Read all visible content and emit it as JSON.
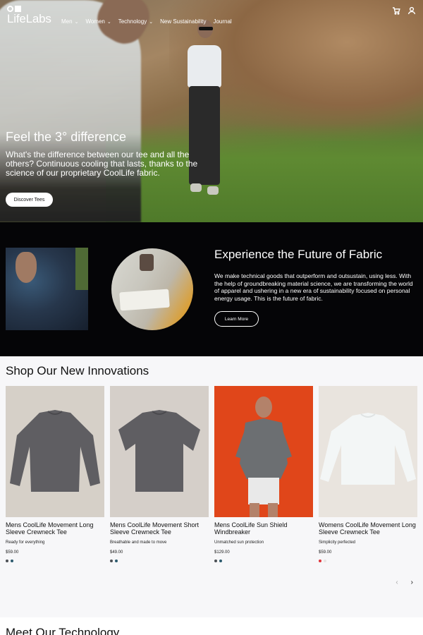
{
  "brand": {
    "name": "LifeLabs"
  },
  "nav": {
    "items": [
      {
        "label": "Men",
        "chevron": true
      },
      {
        "label": "Women",
        "chevron": true
      },
      {
        "label": "Technology",
        "chevron": true
      },
      {
        "label": "New Sustainability",
        "chevron": false
      },
      {
        "label": "Journal",
        "chevron": false
      }
    ],
    "icons": [
      "cart-icon",
      "account-icon"
    ]
  },
  "hero": {
    "title": "Feel the 3° difference",
    "body": "What's the difference between our tee and all the others? Continuous cooling that lasts, thanks to the science of our proprietary CoolLife fabric.",
    "cta": "Discover Tees"
  },
  "fabric": {
    "title": "Experience the Future of Fabric",
    "body": "We make technical goods that outperform and outsustain, using less. With the help of groundbreaking material science, we are transforming the world of apparel and ushering in a new era of sustainability focused on personal energy usage. This is the future of fabric.",
    "cta": "Learn More"
  },
  "shop": {
    "title": "Shop Our New Innovations",
    "products": [
      {
        "name": "Mens CoolLife Movement Long Sleeve Crewneck Tee",
        "tagline": "Ready for everything",
        "price": "$59.00",
        "swatches": [
          "#4b4f55",
          "#2c5b6e"
        ]
      },
      {
        "name": "Mens CoolLife Movement Short Sleeve Crewneck Tee",
        "tagline": "Breathable and made to move",
        "price": "$49.00",
        "swatches": [
          "#4b4f55",
          "#2c5b6e"
        ]
      },
      {
        "name": "Mens CoolLife Sun Shield Windbreaker",
        "tagline": "Unmatched sun protection",
        "price": "$129.00",
        "swatches": [
          "#4b4f55",
          "#2c5b6e"
        ]
      },
      {
        "name": "Womens CoolLife Movement Long Sleeve Crewneck Tee",
        "tagline": "Simplicity perfected",
        "price": "$59.00",
        "swatches": [
          "#e0343a",
          "#e8e4e2"
        ]
      }
    ],
    "prev_label": "‹",
    "next_label": "›"
  },
  "tech": {
    "title": "Meet Our Technology"
  }
}
